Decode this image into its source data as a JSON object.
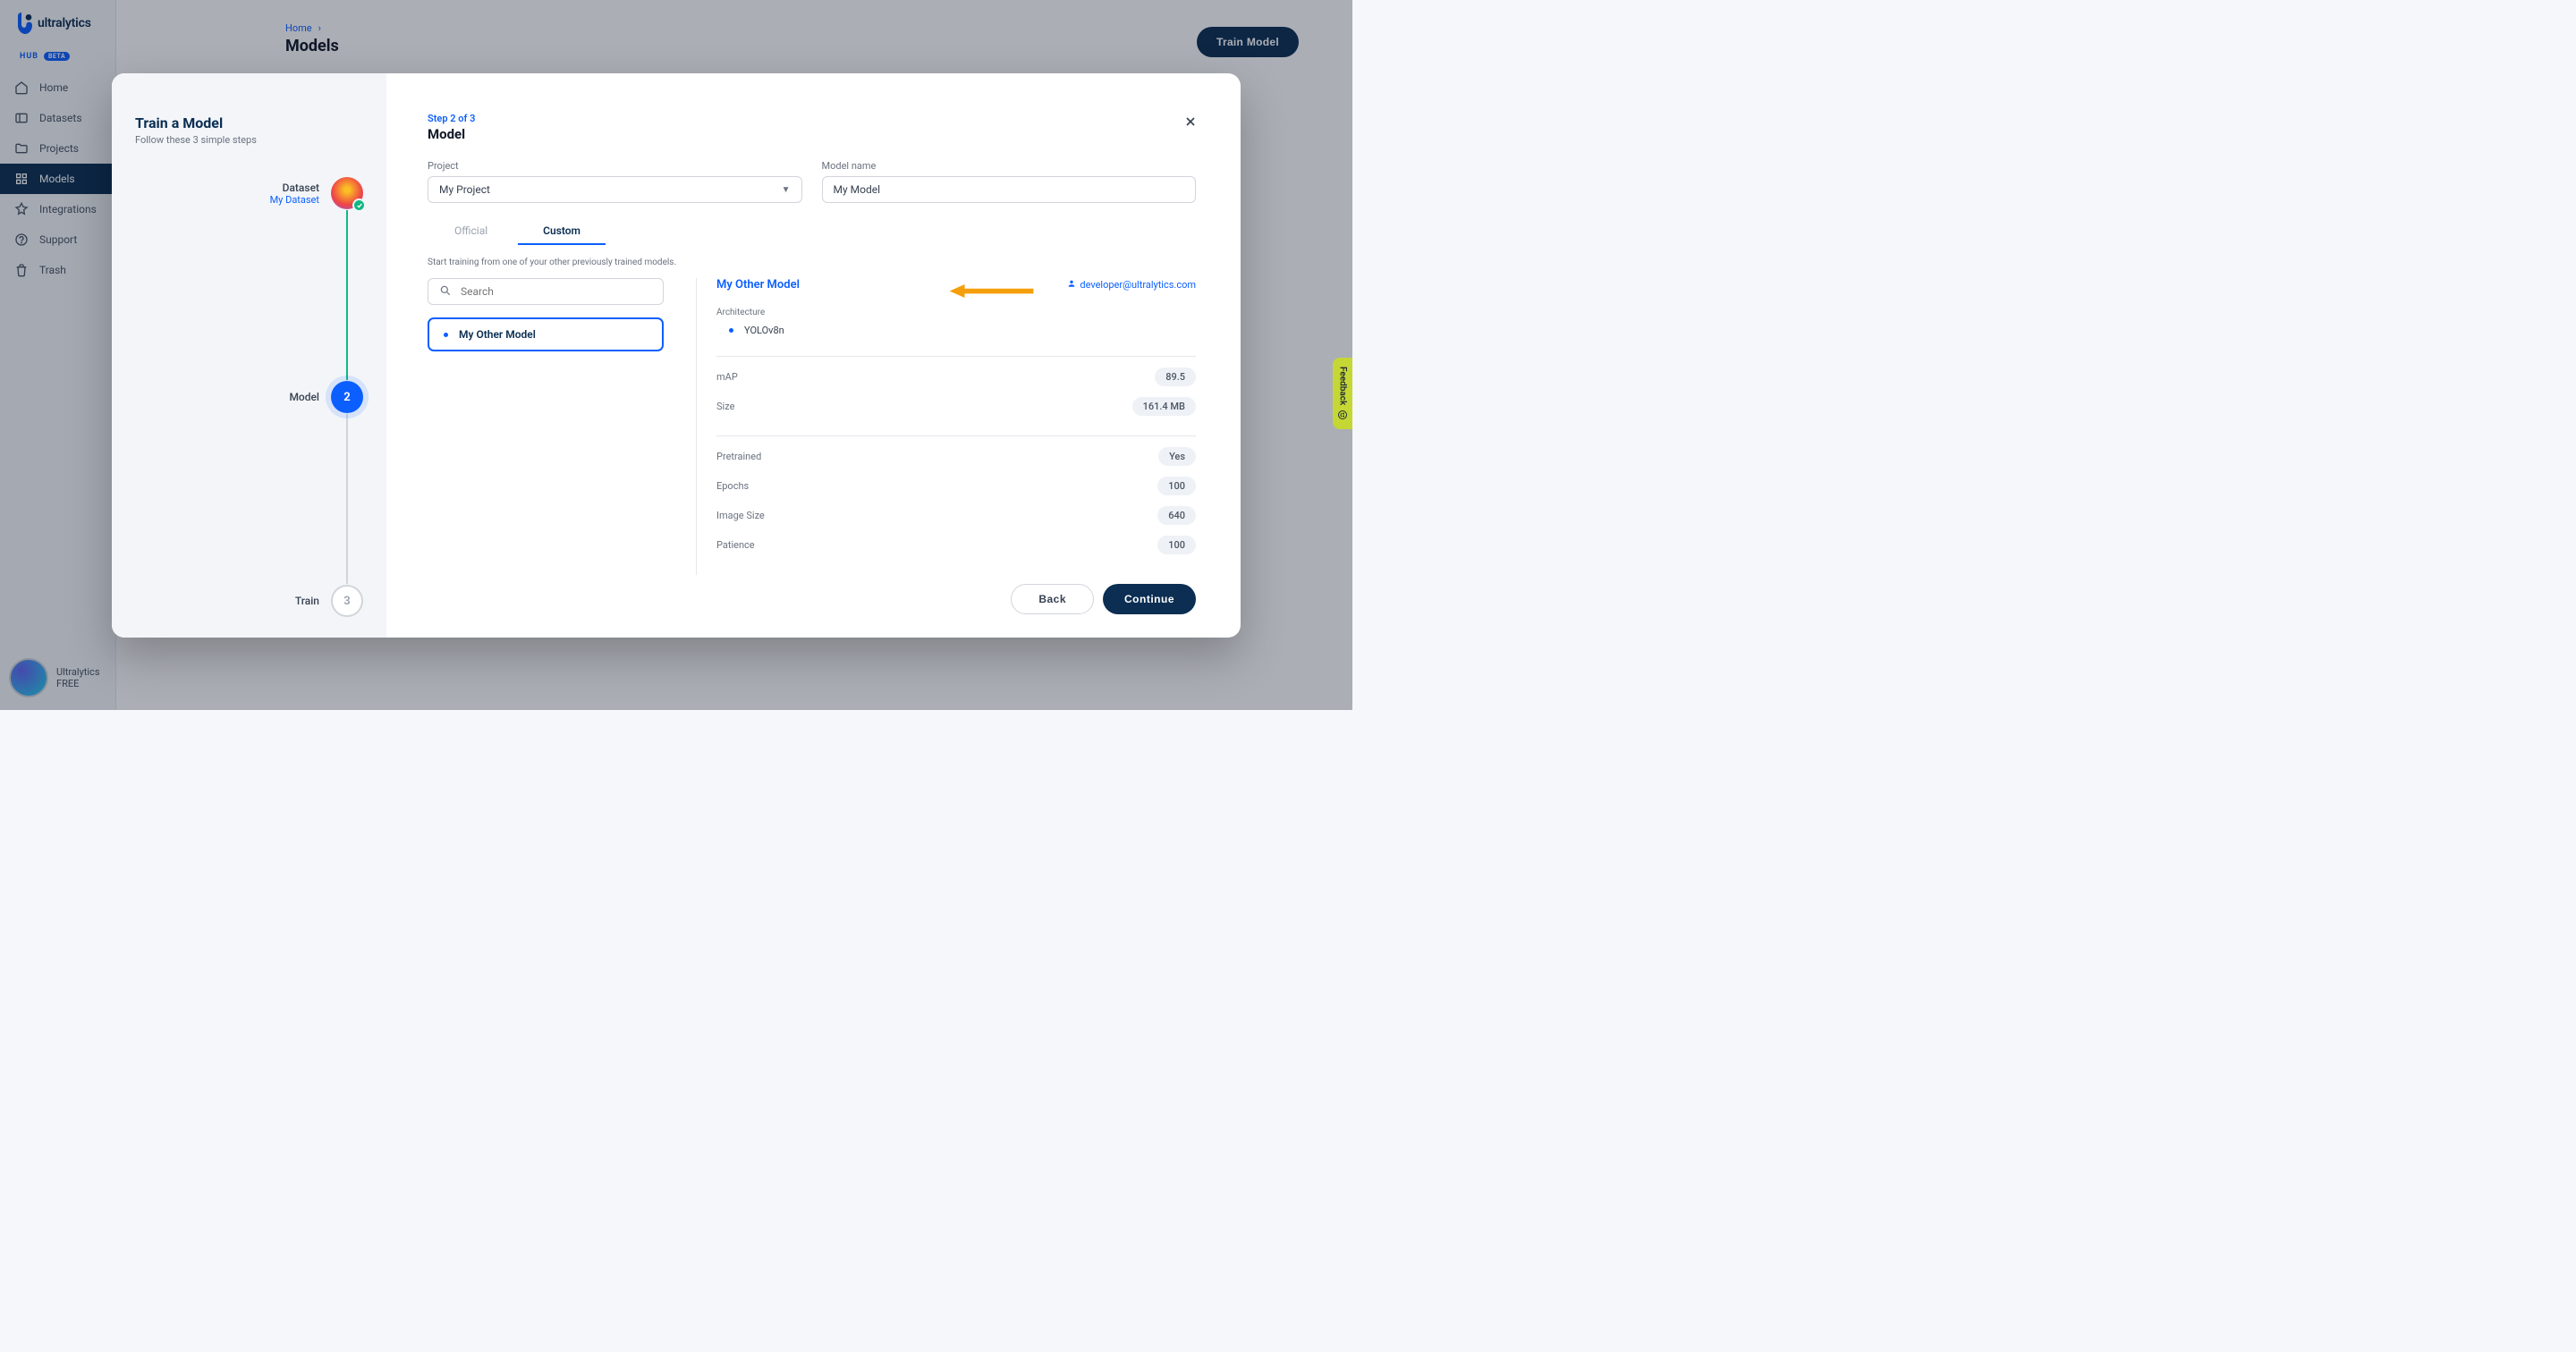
{
  "brand": {
    "name": "ultralytics",
    "hub": "HUB",
    "beta": "BETA"
  },
  "nav": {
    "home": "Home",
    "datasets": "Datasets",
    "projects": "Projects",
    "models": "Models",
    "integrations": "Integrations",
    "support": "Support",
    "trash": "Trash"
  },
  "user": {
    "name": "Ultralytics",
    "plan": "FREE"
  },
  "header": {
    "breadcrumb_home": "Home",
    "page_title": "Models",
    "train_btn": "Train Model"
  },
  "modal": {
    "left": {
      "title": "Train a Model",
      "subtitle": "Follow these 3 simple steps",
      "step1_label": "Dataset",
      "step1_sub": "My Dataset",
      "step2_label": "Model",
      "step2_num": "2",
      "step3_label": "Train",
      "step3_num": "3"
    },
    "step_indicator": "Step 2 of 3",
    "section_title": "Model",
    "project_label": "Project",
    "project_value": "My Project",
    "modelname_label": "Model name",
    "modelname_value": "My Model",
    "tabs": {
      "official": "Official",
      "custom": "Custom"
    },
    "tab_desc": "Start training from one of your other previously trained models.",
    "search_placeholder": "Search",
    "model_card": "My Other Model",
    "details": {
      "title": "My Other Model",
      "owner": "developer@ultralytics.com",
      "arch_label": "Architecture",
      "arch_value": "YOLOv8n",
      "stats": {
        "map_label": "mAP",
        "map_value": "89.5",
        "size_label": "Size",
        "size_value": "161.4 MB",
        "pretrained_label": "Pretrained",
        "pretrained_value": "Yes",
        "epochs_label": "Epochs",
        "epochs_value": "100",
        "imgsize_label": "Image Size",
        "imgsize_value": "640",
        "patience_label": "Patience",
        "patience_value": "100"
      }
    },
    "back_btn": "Back",
    "continue_btn": "Continue"
  },
  "feedback": "Feedback"
}
